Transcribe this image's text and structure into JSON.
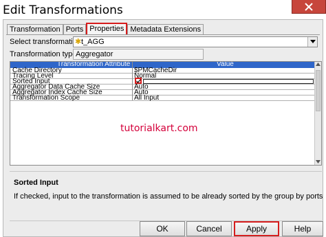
{
  "window": {
    "title": "Edit Transformations"
  },
  "tabs": [
    {
      "label": "Transformation"
    },
    {
      "label": "Ports"
    },
    {
      "label": "Properties"
    },
    {
      "label": "Metadata Extensions"
    }
  ],
  "select_transformation": {
    "label": "Select transformation:",
    "value": "t_AGG"
  },
  "transformation_type": {
    "label": "Transformation type:",
    "value": "Aggregator"
  },
  "grid": {
    "headers": {
      "attribute": "Transformation Attribute",
      "value": "Value"
    },
    "rows": [
      {
        "attribute": "Cache Directory",
        "value": "$PMCacheDir"
      },
      {
        "attribute": "Tracing Level",
        "value": "Normal"
      },
      {
        "attribute": "Sorted Input",
        "value": ""
      },
      {
        "attribute": "Aggregator Data Cache Size",
        "value": "Auto"
      },
      {
        "attribute": "Aggregator Index Cache Size",
        "value": "Auto"
      },
      {
        "attribute": "Transformation Scope",
        "value": "All Input"
      }
    ]
  },
  "watermark": "tutorialkart.com",
  "description": {
    "title": "Sorted Input",
    "text": "If checked, input to the transformation is assumed to be already sorted by the group by ports"
  },
  "buttons": {
    "ok": "OK",
    "cancel": "Cancel",
    "apply": "Apply",
    "help": "Help"
  },
  "colors": {
    "grid_header": "#2f66c9",
    "highlight": "#d61c1c",
    "close_button": "#c7463c",
    "watermark": "#d4003a"
  },
  "icons": {
    "close": "close-icon",
    "dropdown": "chevron-down-icon",
    "transformation": "star-icon",
    "checkbox": "checkmark-icon"
  }
}
